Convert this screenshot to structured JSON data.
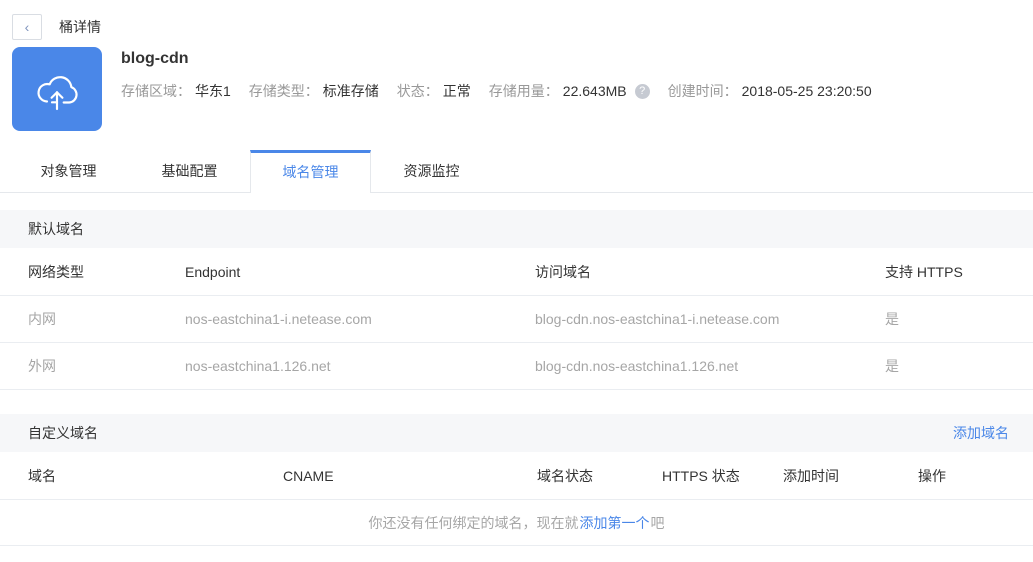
{
  "topbar": {
    "title": "桶详情",
    "back_icon": "‹"
  },
  "bucket": {
    "name": "blog-cdn",
    "help_icon": "?",
    "meta": [
      {
        "label": "存储区域：",
        "value": "华东1"
      },
      {
        "label": "存储类型：",
        "value": "标准存储"
      },
      {
        "label": "状态：",
        "value": "正常"
      },
      {
        "label": "存储用量：",
        "value": "22.643MB"
      },
      {
        "label": "创建时间：",
        "value": "2018-05-25 23:20:50"
      }
    ]
  },
  "tabs": {
    "active_index": 2,
    "items": [
      {
        "label": "对象管理"
      },
      {
        "label": "基础配置"
      },
      {
        "label": "域名管理"
      },
      {
        "label": "资源监控"
      }
    ]
  },
  "default_domains": {
    "section_title": "默认域名",
    "columns": [
      "网络类型",
      "Endpoint",
      "访问域名",
      "支持 HTTPS"
    ],
    "rows": [
      [
        "内网",
        "nos-eastchina1-i.netease.com",
        "blog-cdn.nos-eastchina1-i.netease.com",
        "是"
      ],
      [
        "外网",
        "nos-eastchina1.126.net",
        "blog-cdn.nos-eastchina1.126.net",
        "是"
      ]
    ]
  },
  "custom_domains": {
    "section_title": "自定义域名",
    "add_link": "添加域名",
    "columns": [
      "域名",
      "CNAME",
      "域名状态",
      "HTTPS 状态",
      "添加时间",
      "操作"
    ],
    "empty": {
      "prefix": "你还没有任何绑定的域名，现在就",
      "link": "添加第一个",
      "suffix": "吧"
    }
  },
  "colors": {
    "accent": "#4a87e8",
    "icon_bg": "#4a87e8"
  }
}
